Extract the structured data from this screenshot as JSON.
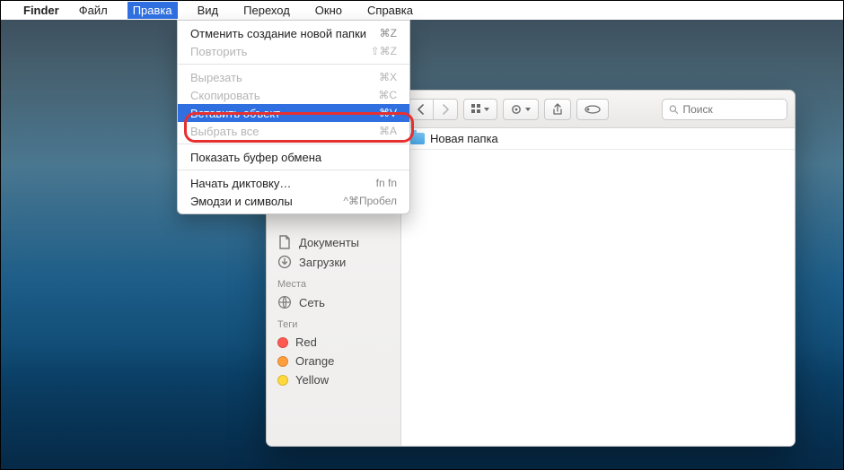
{
  "menubar": {
    "apple_icon": "",
    "app_name": "Finder",
    "items": [
      "Файл",
      "Правка",
      "Вид",
      "Переход",
      "Окно",
      "Справка"
    ],
    "open_index": 1
  },
  "edit_menu": {
    "undo": {
      "label": "Отменить создание новой папки",
      "shortcut": "⌘Z"
    },
    "redo": {
      "label": "Повторить",
      "shortcut": "⇧⌘Z"
    },
    "cut": {
      "label": "Вырезать",
      "shortcut": "⌘X"
    },
    "copy": {
      "label": "Скопировать",
      "shortcut": "⌘C"
    },
    "paste": {
      "label": "Вставить объект",
      "shortcut": "⌘V"
    },
    "selall": {
      "label": "Выбрать все",
      "shortcut": "⌘A"
    },
    "clip": {
      "label": "Показать буфер обмена",
      "shortcut": ""
    },
    "dict": {
      "label": "Начать диктовку…",
      "shortcut": "fn fn"
    },
    "emoji": {
      "label": "Эмодзи и символы",
      "shortcut": "^⌘Пробел"
    }
  },
  "finder": {
    "path_title": "Новая папка",
    "search_placeholder": "Поиск",
    "sidebar": {
      "fav_items": [
        {
          "label": "Документы",
          "icon": "document"
        },
        {
          "label": "Загрузки",
          "icon": "download"
        }
      ],
      "places_label": "Места",
      "places_items": [
        {
          "label": "Сеть",
          "icon": "network"
        }
      ],
      "tags_label": "Теги",
      "tags_items": [
        {
          "label": "Red",
          "color": "#ff5a4f"
        },
        {
          "label": "Orange",
          "color": "#ff9e3d"
        },
        {
          "label": "Yellow",
          "color": "#ffd93b"
        }
      ]
    }
  }
}
